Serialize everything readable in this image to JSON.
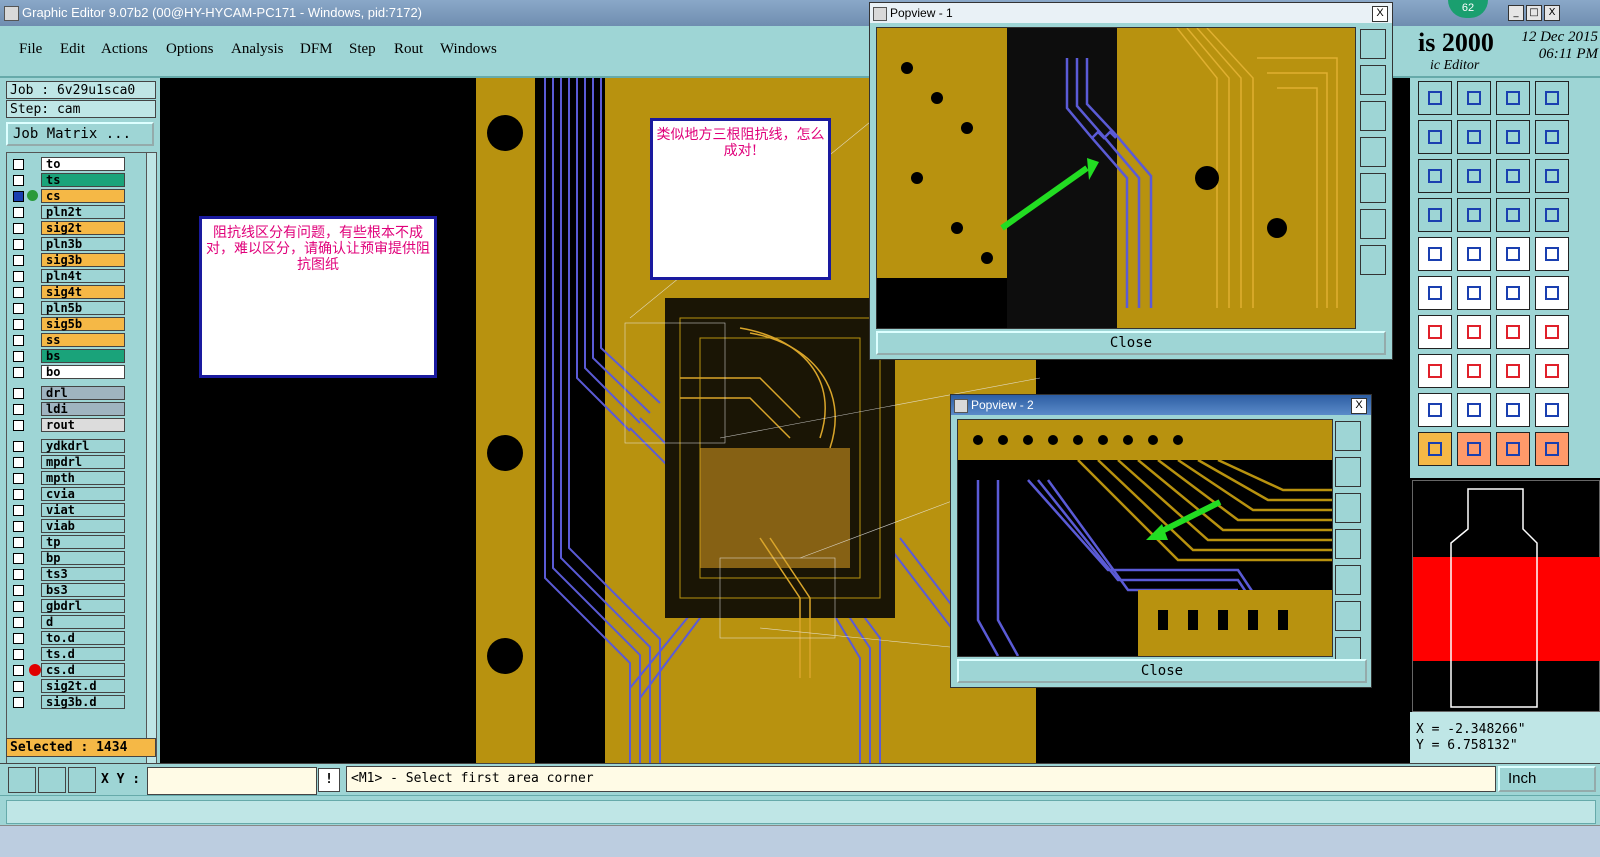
{
  "window": {
    "title": "Graphic Editor 9.07b2 (00@HY-HYCAM-PC171 - Windows, pid:7172)",
    "minimize": "_",
    "restore": "□",
    "close": "X"
  },
  "menu": [
    "File",
    "Edit",
    "Actions",
    "Options",
    "Analysis",
    "DFM",
    "Step",
    "Rout",
    "Windows"
  ],
  "brand": {
    "name": "is 2000",
    "subtitle": "ic Editor",
    "badge": "62",
    "date": "12 Dec 2015",
    "time": "06:11 PM"
  },
  "job": {
    "job_label": "Job : 6v29u1sca0",
    "step_label": "Step: cam",
    "matrix_button": "Job Matrix ..."
  },
  "layers": [
    {
      "name": "to",
      "color": "#ffffff",
      "checked": false
    },
    {
      "name": "ts",
      "color": "#1aa37a",
      "checked": false
    },
    {
      "name": "cs",
      "color": "#f5b846",
      "checked": true,
      "work": true
    },
    {
      "name": "pln2t",
      "color": "#9ed5d5",
      "checked": false
    },
    {
      "name": "sig2t",
      "color": "#f5b846",
      "checked": false
    },
    {
      "name": "pln3b",
      "color": "#9ed5d5",
      "checked": false
    },
    {
      "name": "sig3b",
      "color": "#f5b846",
      "checked": false
    },
    {
      "name": "pln4t",
      "color": "#9ed5d5",
      "checked": false
    },
    {
      "name": "sig4t",
      "color": "#f5b846",
      "checked": false
    },
    {
      "name": "pln5b",
      "color": "#9ed5d5",
      "checked": false
    },
    {
      "name": "sig5b",
      "color": "#f5b846",
      "checked": false
    },
    {
      "name": "ss",
      "color": "#f5b846",
      "checked": false
    },
    {
      "name": "bs",
      "color": "#1aa37a",
      "checked": false
    },
    {
      "name": "bo",
      "color": "#ffffff",
      "checked": false
    },
    {
      "name": "drl",
      "color": "#9fb4c0",
      "checked": false
    },
    {
      "name": "ldi",
      "color": "#9fb4c0",
      "checked": false
    },
    {
      "name": "rout",
      "color": "#dcdcdc",
      "checked": false
    },
    {
      "name": "ydkdrl",
      "color": "#9ed5d5",
      "checked": false
    },
    {
      "name": "mpdrl",
      "color": "#9ed5d5",
      "checked": false
    },
    {
      "name": "mpth",
      "color": "#9ed5d5",
      "checked": false
    },
    {
      "name": "cvia",
      "color": "#9ed5d5",
      "checked": false
    },
    {
      "name": "viat",
      "color": "#9ed5d5",
      "checked": false
    },
    {
      "name": "viab",
      "color": "#9ed5d5",
      "checked": false
    },
    {
      "name": "tp",
      "color": "#9ed5d5",
      "checked": false
    },
    {
      "name": "bp",
      "color": "#9ed5d5",
      "checked": false
    },
    {
      "name": "ts3",
      "color": "#9ed5d5",
      "checked": false
    },
    {
      "name": "bs3",
      "color": "#9ed5d5",
      "checked": false
    },
    {
      "name": "gbdrl",
      "color": "#9ed5d5",
      "checked": false
    },
    {
      "name": "d",
      "color": "#9ed5d5",
      "checked": false
    },
    {
      "name": "to.d",
      "color": "#9ed5d5",
      "checked": false
    },
    {
      "name": "ts.d",
      "color": "#9ed5d5",
      "checked": false
    },
    {
      "name": "cs.d",
      "color": "#9ed5d5",
      "checked": false,
      "marker": true
    },
    {
      "name": "sig2t.d",
      "color": "#9ed5d5",
      "checked": false
    },
    {
      "name": "sig3b.d",
      "color": "#9ed5d5",
      "checked": false
    }
  ],
  "selected": "Selected : 1434",
  "notes": {
    "left": "阻抗线区分有问题，有些根本不成对，难以区分，请确认让预审提供阻抗图纸",
    "top": "类似地方三根阻抗线，怎么成对!"
  },
  "popview1": {
    "title": "Popview - 1",
    "close_label": "Close",
    "x": "X"
  },
  "popview2": {
    "title": "Popview - 2",
    "close_label": "Close",
    "x": "X"
  },
  "coords": {
    "x": "X = -2.348266\"",
    "y": "Y = 6.758132\""
  },
  "bottom": {
    "xy_label": "X Y :",
    "xy_value": "",
    "excl": "!",
    "prompt": "<M1> - Select first area corner",
    "unit": "Inch"
  },
  "colors": {
    "accent": "#9ed5d5",
    "copper": "#b8920f",
    "trace_blue": "#5b5bd6",
    "layer_orange": "#f5b846",
    "note_text": "#e0007a",
    "arrow_green": "#22dd22"
  }
}
